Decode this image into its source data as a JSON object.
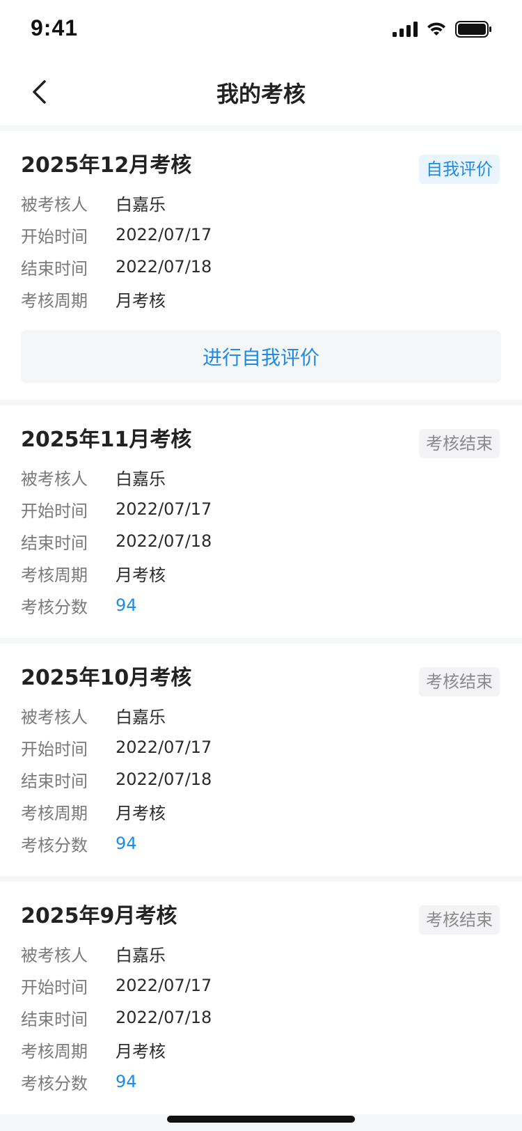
{
  "status_bar": {
    "time": "9:41"
  },
  "nav": {
    "title": "我的考核"
  },
  "colors": {
    "accent": "#1e8be6",
    "ended_badge_text": "#8a8a8a",
    "label": "#7a7a7a"
  },
  "field_labels": {
    "assessee": "被考核人",
    "start_time": "开始时间",
    "end_time": "结束时间",
    "period": "考核周期",
    "score": "考核分数"
  },
  "cards": [
    {
      "title": "2025年12月考核",
      "badge": "自我评价",
      "badge_state": "active",
      "assessee": "白嘉乐",
      "start_time": "2022/07/17",
      "end_time": "2022/07/18",
      "period": "月考核",
      "action_label": "进行自我评价"
    },
    {
      "title": "2025年11月考核",
      "badge": "考核结束",
      "badge_state": "ended",
      "assessee": "白嘉乐",
      "start_time": "2022/07/17",
      "end_time": "2022/07/18",
      "period": "月考核",
      "score": "94"
    },
    {
      "title": "2025年10月考核",
      "badge": "考核结束",
      "badge_state": "ended",
      "assessee": "白嘉乐",
      "start_time": "2022/07/17",
      "end_time": "2022/07/18",
      "period": "月考核",
      "score": "94"
    },
    {
      "title": "2025年9月考核",
      "badge": "考核结束",
      "badge_state": "ended",
      "assessee": "白嘉乐",
      "start_time": "2022/07/17",
      "end_time": "2022/07/18",
      "period": "月考核",
      "score": "94"
    }
  ]
}
